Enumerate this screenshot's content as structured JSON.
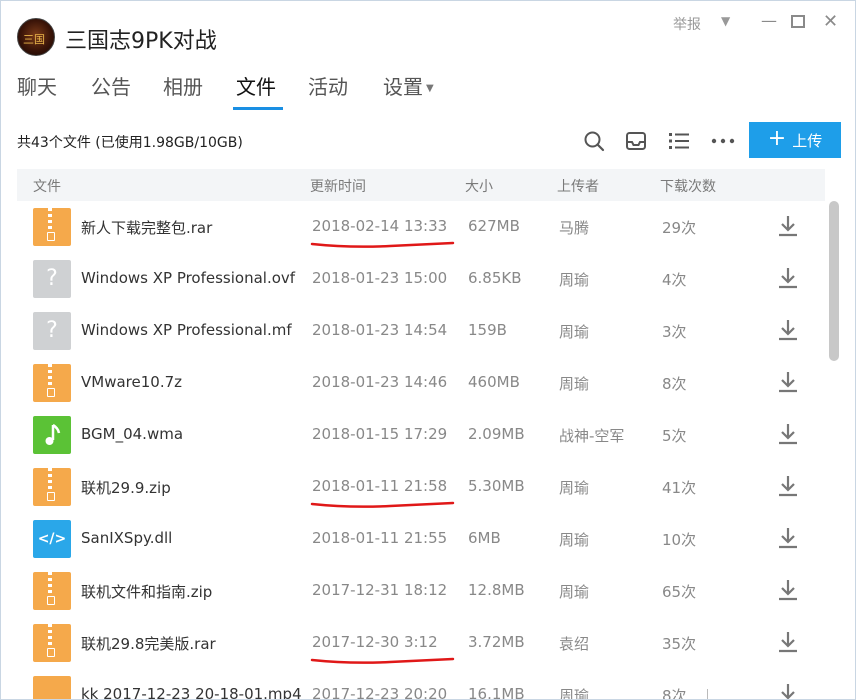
{
  "window": {
    "title": "三国志9PK对战",
    "report_label": "举报"
  },
  "tabs": [
    {
      "label": "聊天"
    },
    {
      "label": "公告"
    },
    {
      "label": "相册"
    },
    {
      "label": "文件"
    },
    {
      "label": "活动"
    },
    {
      "label": "设置"
    }
  ],
  "active_tab": "文件",
  "toolbar": {
    "file_count_text": "共43个文件 (已使用1.98GB/10GB)",
    "upload_label": "上传"
  },
  "table": {
    "headers": {
      "name": "文件",
      "updated": "更新时间",
      "size": "大小",
      "uploader": "上传者",
      "downloads": "下载次数"
    },
    "rows": [
      {
        "name": "新人下载完整包.rar",
        "icon": "zip-file-icon",
        "updated": "2018-02-14 13:33",
        "size": "627MB",
        "uploader": "马腾",
        "downloads": "29次",
        "highlighted": true
      },
      {
        "name": "Windows XP Professional.ovf",
        "icon": "unknown-file-icon",
        "updated": "2018-01-23 15:00",
        "size": "6.85KB",
        "uploader": "周瑜",
        "downloads": "4次",
        "highlighted": false
      },
      {
        "name": "Windows XP Professional.mf",
        "icon": "unknown-file-icon",
        "updated": "2018-01-23 14:54",
        "size": "159B",
        "uploader": "周瑜",
        "downloads": "3次",
        "highlighted": false
      },
      {
        "name": "VMware10.7z",
        "icon": "zip-file-icon",
        "updated": "2018-01-23 14:46",
        "size": "460MB",
        "uploader": "周瑜",
        "downloads": "8次",
        "highlighted": false
      },
      {
        "name": "BGM_04.wma",
        "icon": "audio-file-icon",
        "updated": "2018-01-15 17:29",
        "size": "2.09MB",
        "uploader": "战神-空军",
        "downloads": "5次",
        "highlighted": false
      },
      {
        "name": "联机29.9.zip",
        "icon": "zip-file-icon",
        "updated": "2018-01-11 21:58",
        "size": "5.30MB",
        "uploader": "周瑜",
        "downloads": "41次",
        "highlighted": true
      },
      {
        "name": "SanIXSpy.dll",
        "icon": "code-file-icon",
        "updated": "2018-01-11 21:55",
        "size": "6MB",
        "uploader": "周瑜",
        "downloads": "10次",
        "highlighted": false
      },
      {
        "name": "联机文件和指南.zip",
        "icon": "zip-file-icon",
        "updated": "2017-12-31 18:12",
        "size": "12.8MB",
        "uploader": "周瑜",
        "downloads": "65次",
        "highlighted": false
      },
      {
        "name": "联机29.8完美版.rar",
        "icon": "zip-file-icon",
        "updated": "2017-12-30 3:12",
        "size": "3.72MB",
        "uploader": "袁绍",
        "downloads": "35次",
        "highlighted": true
      },
      {
        "name": "kk 2017-12-23 20-18-01.mp4",
        "icon": "video-file-icon",
        "updated": "2017-12-23 20:20",
        "size": "16.1MB",
        "uploader": "周瑜",
        "downloads": "8次",
        "highlighted": false
      }
    ]
  },
  "colors": {
    "accent": "#1e9ee9",
    "tab_underline": "#1a8fe3",
    "annotation_red": "#e01818",
    "zip_icon": "#f5a94b",
    "audio_icon": "#5bc236",
    "code_icon": "#2aa7e9"
  }
}
